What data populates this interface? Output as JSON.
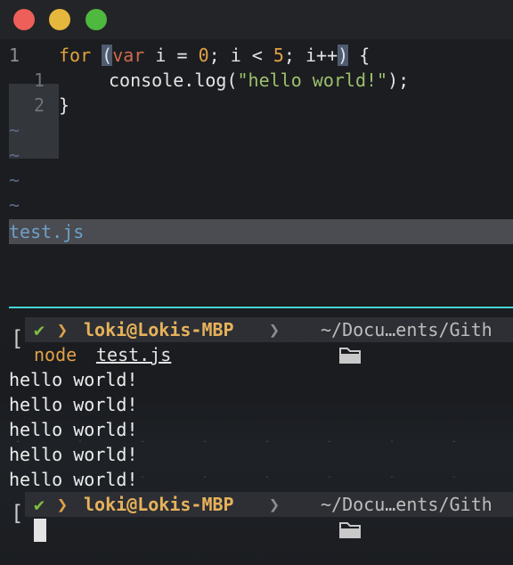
{
  "window": {
    "traffic_lights": [
      "close",
      "minimize",
      "zoom"
    ]
  },
  "editor": {
    "gutter": [
      "1",
      "1",
      "2"
    ],
    "code": {
      "line1": {
        "kw_for": "for",
        "open_paren": "(",
        "kw_var": "var",
        "mid": " i = ",
        "n0": "0",
        "mid2": "; i < ",
        "n5": "5",
        "mid3": "; i++",
        "close_paren": ")",
        "tail": " {"
      },
      "line2": {
        "pre": "console.log(",
        "str": "\"hello world!\"",
        "post": ");"
      },
      "line3": {
        "text": "}"
      }
    },
    "tilde": "~",
    "filename": "test.js"
  },
  "terminal": {
    "bracket": "[",
    "check": "✔",
    "chevron": "❯",
    "host": "loki@Lokis-MBP",
    "path": "~/Docu…ents/Gith",
    "command": "node",
    "argument": "test.js",
    "output": [
      "hello world!",
      "hello world!",
      "hello world!",
      "hello world!",
      "hello world!"
    ]
  }
}
